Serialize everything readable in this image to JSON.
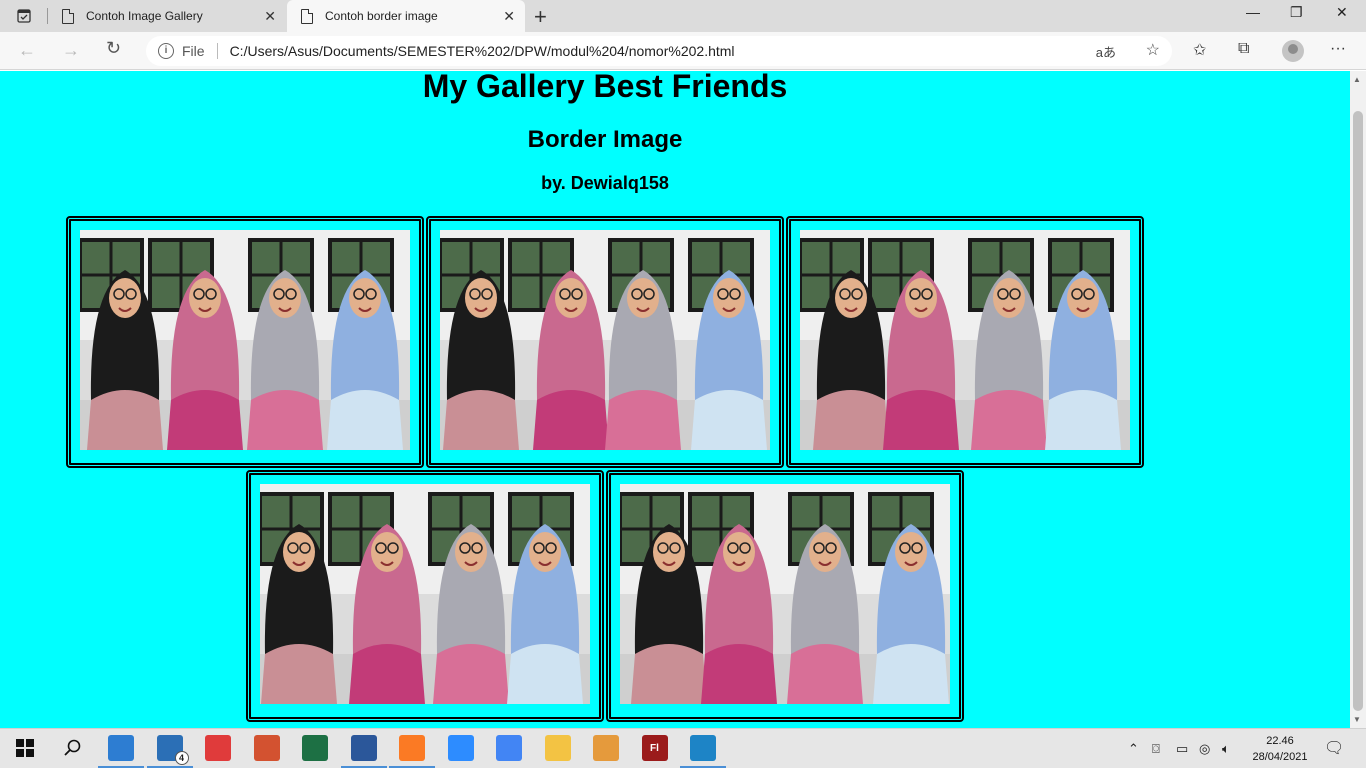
{
  "browser": {
    "tabs": [
      {
        "title": "Contoh Image Gallery",
        "active": false
      },
      {
        "title": "Contoh border image",
        "active": true
      }
    ],
    "address": {
      "scheme_label": "File",
      "url": "C:/Users/Asus/Documents/SEMESTER%202/DPW/modul%204/nomor%202.html"
    },
    "icons": {
      "back": "arrow-left-icon",
      "forward": "arrow-right-icon",
      "reload": "reload-icon",
      "info": "info-icon",
      "read_aloud": "read-aloud-icon",
      "add_favorite": "star-plus-icon",
      "favorites": "favorites-icon",
      "collections": "collections-icon",
      "profile": "profile-icon",
      "more": "more-icon"
    },
    "read_aloud_glyph": "aあ"
  },
  "page": {
    "background": "#00ffff",
    "title": "My Gallery Best Friends",
    "subtitle": "Border Image",
    "byline": "by. Dewialq158",
    "photos": [
      {
        "alt": "Four friends in hijabs posing in a classroom",
        "pose": 1
      },
      {
        "alt": "Four friends in hijabs making playful gestures",
        "pose": 2
      },
      {
        "alt": "Four friends in hijabs laughing together",
        "pose": 3
      },
      {
        "alt": "Four friends in hijabs hugging and smiling",
        "pose": 4
      },
      {
        "alt": "Four friends in hijabs close together smiling",
        "pose": 5
      }
    ],
    "frame_border": "double black"
  },
  "taskbar": {
    "apps": [
      {
        "name": "start",
        "icon": "windows-icon"
      },
      {
        "name": "search",
        "icon": "search-icon"
      },
      {
        "name": "vscode",
        "icon": "vscode-icon",
        "color": "#2d7dd2"
      },
      {
        "name": "mail",
        "icon": "mail-icon",
        "badge": "4",
        "color": "#2b6fb6"
      },
      {
        "name": "gift",
        "icon": "gift-icon",
        "color": "#e03b3b"
      },
      {
        "name": "powerpoint",
        "icon": "powerpoint-icon",
        "color": "#d35230"
      },
      {
        "name": "excel",
        "icon": "excel-icon",
        "color": "#1d7044"
      },
      {
        "name": "word",
        "icon": "word-icon",
        "color": "#2b579a"
      },
      {
        "name": "xampp",
        "icon": "xampp-icon",
        "color": "#fb7a24"
      },
      {
        "name": "zoom",
        "icon": "zoom-icon",
        "color": "#2d8cff"
      },
      {
        "name": "chrome",
        "icon": "chrome-icon",
        "color": "#4285f4"
      },
      {
        "name": "explorer",
        "icon": "folder-icon",
        "color": "#f3c343"
      },
      {
        "name": "photos",
        "icon": "photos-icon",
        "color": "#e59a3c"
      },
      {
        "name": "flash",
        "icon": "flash-icon",
        "label": "Fl",
        "color": "#9b1b1b"
      },
      {
        "name": "edge",
        "icon": "edge-icon",
        "color": "#1d84c6"
      }
    ],
    "clock": {
      "time": "22.46",
      "date": "28/04/2021"
    }
  }
}
